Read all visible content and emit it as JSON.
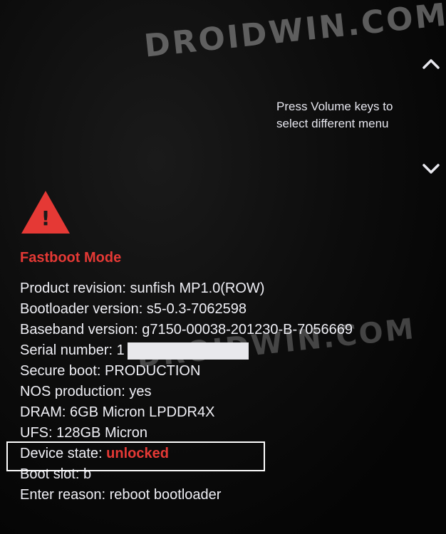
{
  "watermarks": [
    "DROIDWIN.COM",
    "DROIDWIN.COM"
  ],
  "navigation": {
    "up_icon": "chevron-up-icon",
    "down_icon": "chevron-down-icon",
    "hint_line1": "Press Volume keys to",
    "hint_line2": "select different menu"
  },
  "warning": {
    "icon": "warning-triangle-icon",
    "glyph": "!",
    "color": "#e53935"
  },
  "mode_title": "Fastboot Mode",
  "info": [
    {
      "label": "Product revision:",
      "value": "sunfish MP1.0(ROW)"
    },
    {
      "label": "Bootloader version:",
      "value": "s5-0.3-7062598"
    },
    {
      "label": "Baseband version:",
      "value": "g7150-00038-201230-B-7056669"
    },
    {
      "label": "Serial number:",
      "value": "1"
    },
    {
      "label": "Secure boot:",
      "value": "PRODUCTION"
    },
    {
      "label": "NOS production:",
      "value": "yes"
    },
    {
      "label": "DRAM:",
      "value": "6GB Micron LPDDR4X"
    },
    {
      "label": "UFS:",
      "value": "128GB Micron"
    },
    {
      "label": "Device state:",
      "value": "unlocked"
    },
    {
      "label": "Boot slot:",
      "value": "b"
    },
    {
      "label": "Enter reason:",
      "value": "reboot bootloader"
    }
  ],
  "colors": {
    "accent_red": "#e53935",
    "text": "#f0f0f6",
    "background": "#050505"
  }
}
